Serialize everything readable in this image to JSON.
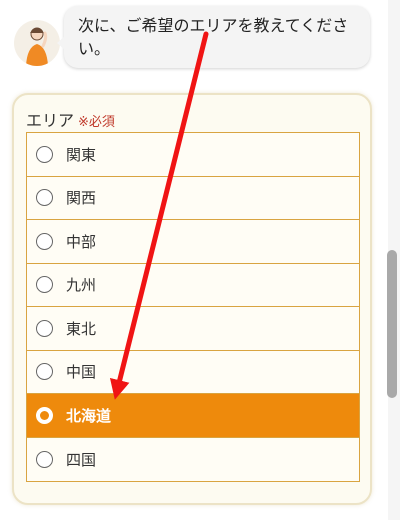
{
  "chat": {
    "message": "次に、ご希望のエリアを教えてください。"
  },
  "area": {
    "label": "エリア",
    "required": "※必須",
    "selected_index": 6,
    "accent_color": "#ee8a0c",
    "border_color": "#d9a441",
    "options": [
      "関東",
      "関西",
      "中部",
      "九州",
      "東北",
      "中国",
      "北海道",
      "四国"
    ]
  }
}
